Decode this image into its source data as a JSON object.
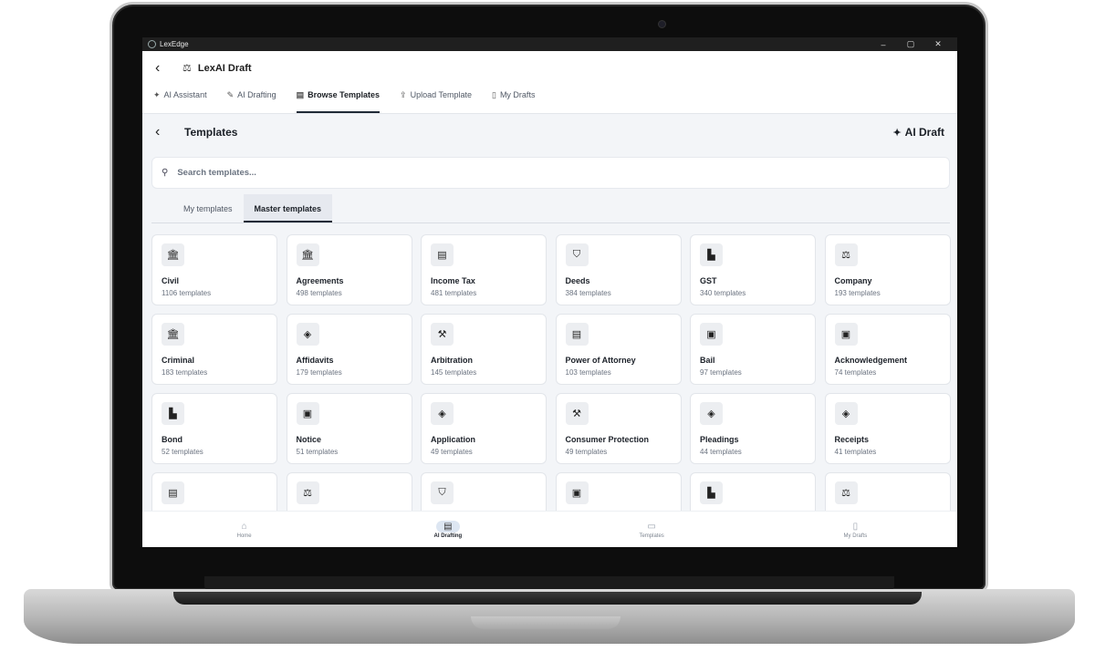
{
  "window": {
    "app_name": "LexEdge",
    "minimize": "–",
    "maximize": "▢",
    "close": "✕"
  },
  "header": {
    "back_icon": "‹",
    "title_icon": "⚖",
    "title": "LexAI Draft"
  },
  "tabs": [
    {
      "icon": "✦",
      "label": "AI Assistant",
      "active": false
    },
    {
      "icon": "✎",
      "label": "AI Drafting",
      "active": false
    },
    {
      "icon": "▤",
      "label": "Browse Templates",
      "active": true
    },
    {
      "icon": "⇪",
      "label": "Upload Template",
      "active": false
    },
    {
      "icon": "▯",
      "label": "My Drafts",
      "active": false
    }
  ],
  "page": {
    "back_icon": "‹",
    "title": "Templates",
    "ai_draft_icon": "✦",
    "ai_draft_label": "AI Draft"
  },
  "search": {
    "icon": "⚲",
    "placeholder": "Search templates..."
  },
  "subtabs": [
    {
      "label": "My templates",
      "active": false
    },
    {
      "label": "Master templates",
      "active": true
    }
  ],
  "categories": [
    {
      "icon": "🏛",
      "name": "Civil",
      "count": "1106 templates"
    },
    {
      "icon": "🏛",
      "name": "Agreements",
      "count": "498 templates"
    },
    {
      "icon": "▤",
      "name": "Income Tax",
      "count": "481 templates"
    },
    {
      "icon": "⛉",
      "name": "Deeds",
      "count": "384 templates"
    },
    {
      "icon": "▙",
      "name": "GST",
      "count": "340 templates"
    },
    {
      "icon": "⚖",
      "name": "Company",
      "count": "193 templates"
    },
    {
      "icon": "🏛",
      "name": "Criminal",
      "count": "183 templates"
    },
    {
      "icon": "◈",
      "name": "Affidavits",
      "count": "179 templates"
    },
    {
      "icon": "⚒",
      "name": "Arbitration",
      "count": "145 templates"
    },
    {
      "icon": "▤",
      "name": "Power of Attorney",
      "count": "103 templates"
    },
    {
      "icon": "▣",
      "name": "Bail",
      "count": "97 templates"
    },
    {
      "icon": "▣",
      "name": "Acknowledgement",
      "count": "74 templates"
    },
    {
      "icon": "▙",
      "name": "Bond",
      "count": "52 templates"
    },
    {
      "icon": "▣",
      "name": "Notice",
      "count": "51 templates"
    },
    {
      "icon": "◈",
      "name": "Application",
      "count": "49 templates"
    },
    {
      "icon": "⚒",
      "name": "Consumer Protection",
      "count": "49 templates"
    },
    {
      "icon": "◈",
      "name": "Pleadings",
      "count": "44 templates"
    },
    {
      "icon": "◈",
      "name": "Receipts",
      "count": "41 templates"
    },
    {
      "icon": "▤",
      "name": "",
      "count": ""
    },
    {
      "icon": "⚖",
      "name": "",
      "count": ""
    },
    {
      "icon": "⛉",
      "name": "",
      "count": ""
    },
    {
      "icon": "▣",
      "name": "",
      "count": ""
    },
    {
      "icon": "▙",
      "name": "",
      "count": ""
    },
    {
      "icon": "⚖",
      "name": "",
      "count": ""
    }
  ],
  "bottom_nav": [
    {
      "icon": "⌂",
      "label": "Home",
      "active": false
    },
    {
      "icon": "▤",
      "label": "AI Drafting",
      "active": true
    },
    {
      "icon": "▭",
      "label": "Templates",
      "active": false
    },
    {
      "icon": "▯",
      "label": "My Drafts",
      "active": false
    }
  ]
}
